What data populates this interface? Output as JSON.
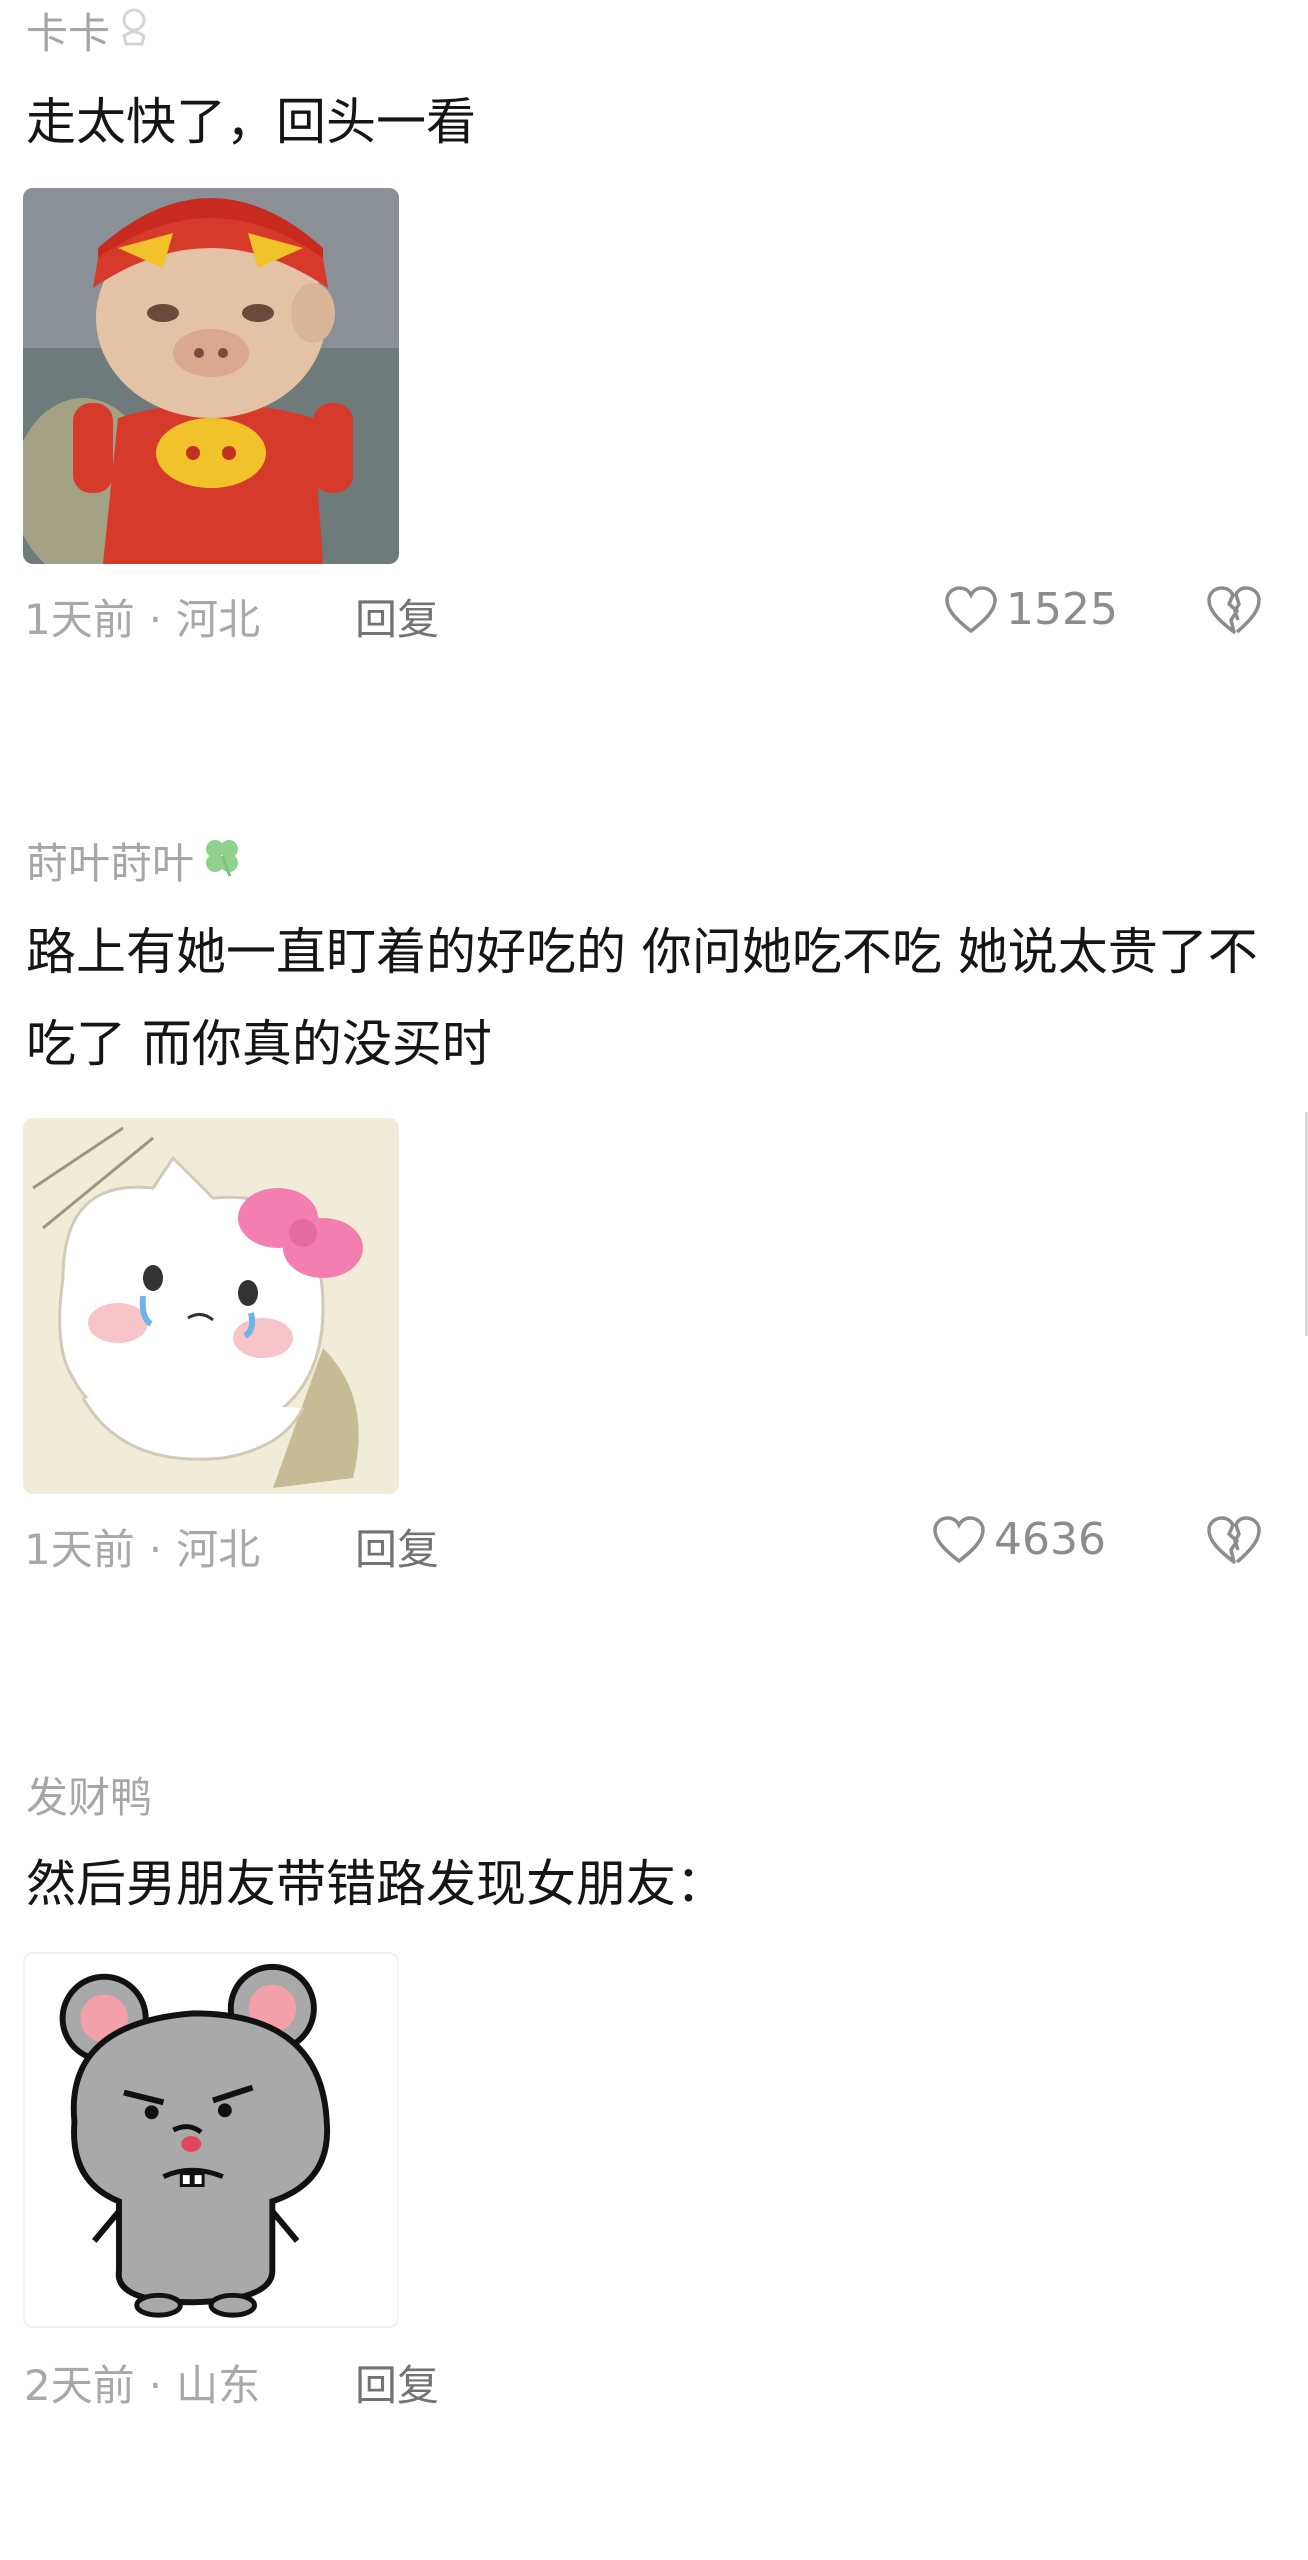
{
  "comments": [
    {
      "username": "卡卡",
      "text": "走太快了，回头一看",
      "time": "1天前",
      "separator": "·",
      "location": "河北",
      "reply_label": "回复",
      "likes": "1525",
      "image_icon": "angry-pig-cartoon-sticker"
    },
    {
      "username": "莳叶莳叶",
      "text": "路上有她一直盯着的好吃的 你问她吃不吃 她说太贵了不吃了 而你真的没买时",
      "time": "1天前",
      "separator": "·",
      "location": "河北",
      "reply_label": "回复",
      "likes": "4636",
      "image_icon": "crying-white-cat-sticker"
    },
    {
      "username": "发财鸭",
      "text": "然后男朋友带错路发现女朋友：",
      "time": "2天前",
      "separator": "·",
      "location": "山东",
      "reply_label": "回复",
      "image_icon": "grumpy-gray-mouse-sticker"
    }
  ],
  "colors": {
    "username": "#a6a6a6",
    "meta": "#a8a8a8",
    "reply": "#737373",
    "clover": "#8fd18f"
  }
}
